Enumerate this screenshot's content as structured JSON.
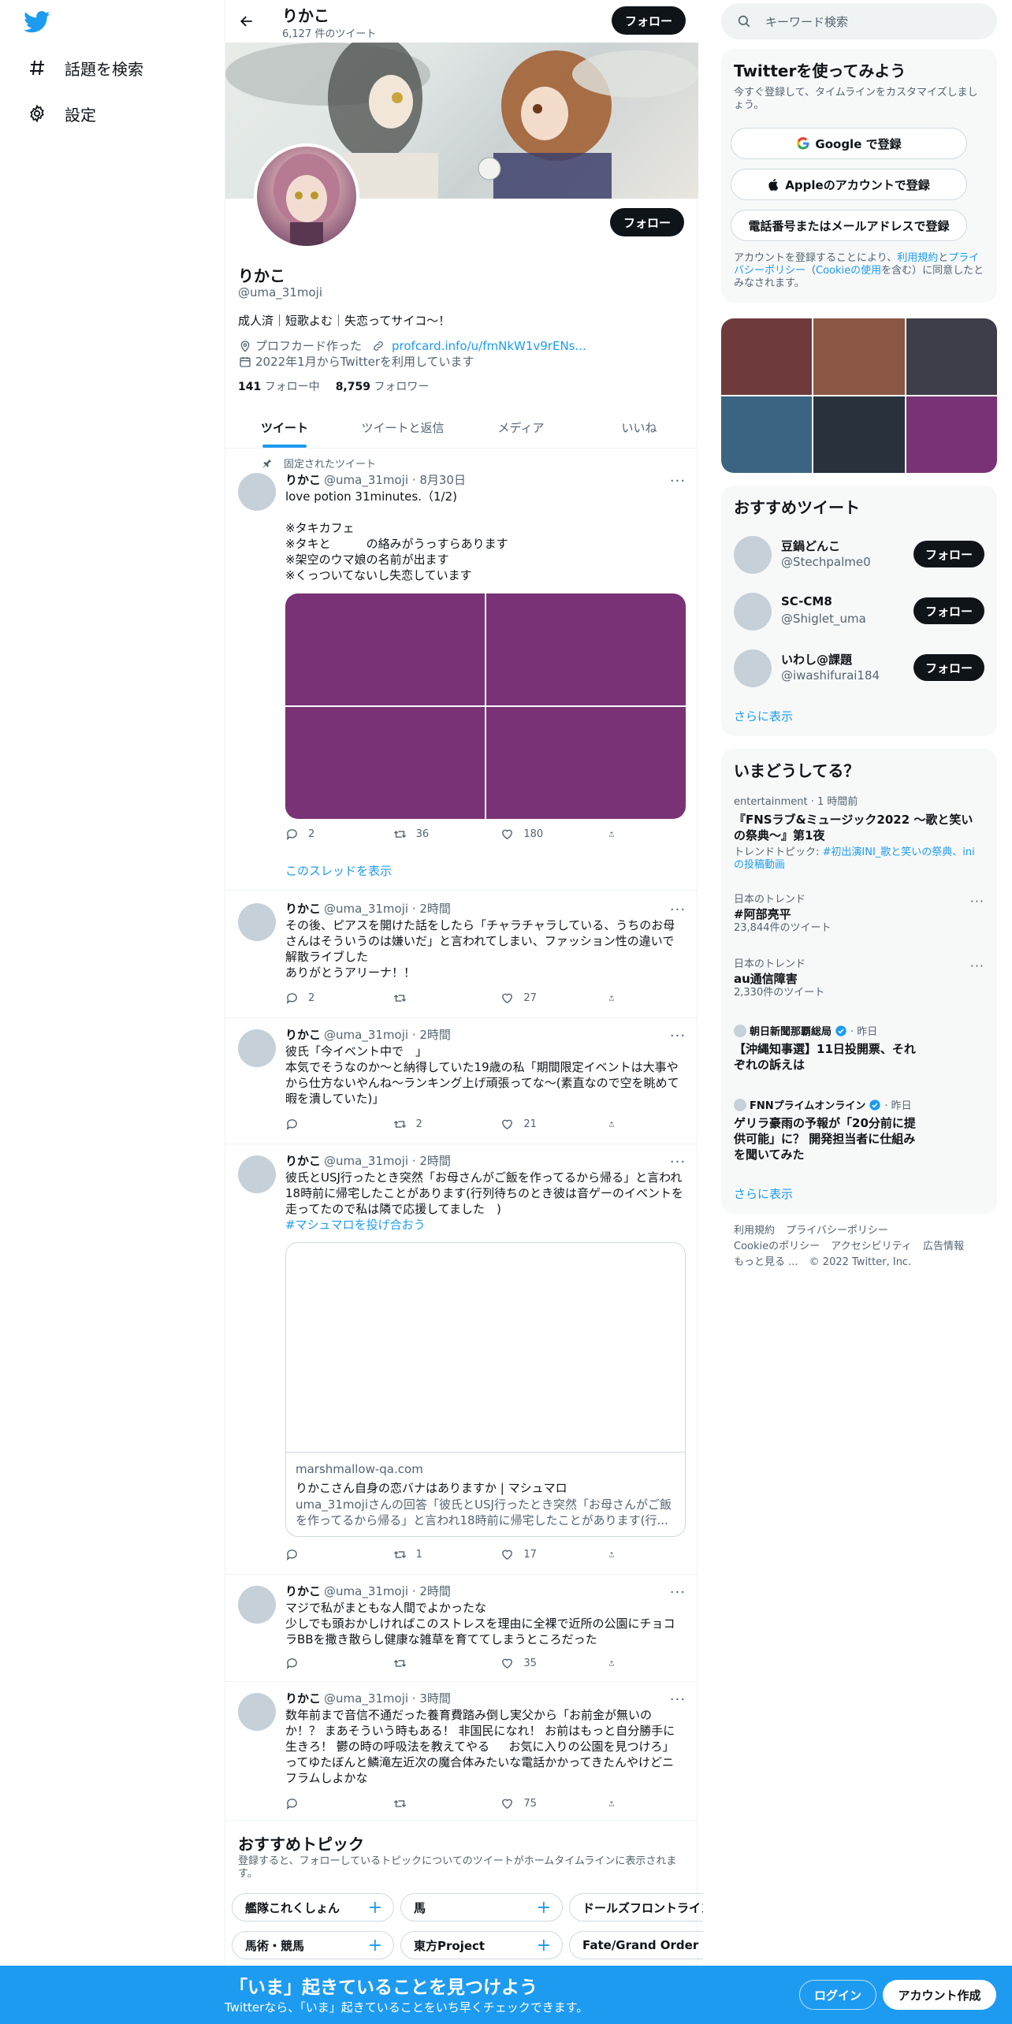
{
  "nav": {
    "items": [
      {
        "icon": "hashtag-icon",
        "label": "話題を検索"
      },
      {
        "icon": "gear-icon",
        "label": "設定"
      }
    ]
  },
  "header": {
    "name": "りかこ",
    "tweet_count": "6,127 件のツイート",
    "follow_label": "フォロー"
  },
  "profile": {
    "name": "りかこ",
    "handle": "@uma_31moji",
    "bio": "成人済｜短歌よむ｜失恋ってサイコ〜！",
    "location": "プロフカード作った",
    "link": "profcard.info/u/fmNkW1v9rENs...",
    "joined": "2022年1月からTwitterを利用しています",
    "following_count": "141",
    "following_label": "フォロー中",
    "followers_count": "8,759",
    "followers_label": "フォロワー",
    "follow_label": "フォロー"
  },
  "tabs": [
    "ツイート",
    "ツイートと返信",
    "メディア",
    "いいね"
  ],
  "tweets": [
    {
      "pinned_label": "固定されたツイート",
      "name": "りかこ",
      "meta": "@uma_31moji · 8月30日",
      "text": "love potion 31minutes.（1/2)\n\n※タキカフェ\n※タキと　　　の絡みがうっすらあります\n※架空のウマ娘の名前が出ます\n※くっついてないし失恋しています",
      "reply": "2",
      "retweet": "36",
      "like": "180",
      "thread_link": "このスレッドを表示"
    },
    {
      "name": "りかこ",
      "meta": "@uma_31moji · 2時間",
      "text": "その後、ピアスを開けた話をしたら「チャラチャラしている、うちのお母さんはそういうのは嫌いだ」と言われてしまい、ファッション性の違いで解散ライブした\nありがとうアリーナ！！",
      "reply": "2",
      "retweet": "",
      "like": "27"
    },
    {
      "name": "りかこ",
      "meta": "@uma_31moji · 2時間",
      "text": "彼氏「今イベント中で　」\n本気でそうなのか〜と納得していた19歳の私「期間限定イベントは大事やから仕方ないやんね〜ランキング上げ頑張ってな〜(素直なので空を眺めて暇を潰していた)」",
      "reply": "",
      "retweet": "2",
      "like": "21"
    },
    {
      "name": "りかこ",
      "meta": "@uma_31moji · 2時間",
      "text": "彼氏とUSJ行ったとき突然「お母さんがご飯を作ってるから帰る」と言われ18時前に帰宅したことがあります(行列待ちのとき彼は音ゲーのイベントを走ってたので私は隣で応援してました　)",
      "hashtag": "#マシュマロを投げ合おう",
      "card_domain": "marshmallow-qa.com",
      "card_title": "りかこさん自身の恋バナはありますか | マシュマロ",
      "card_desc": "uma_31mojiさんの回答「彼氏とUSJ行ったとき突然「お母さんがご飯を作ってるから帰る」と言われ18時前に帰宅したことがあります(行...",
      "reply": "",
      "retweet": "1",
      "like": "17"
    },
    {
      "name": "りかこ",
      "meta": "@uma_31moji · 2時間",
      "text": "マジで私がまともな人間でよかったな\n少しでも頭おかしければこのストレスを理由に全裸で近所の公園にチョコラBBを撒き散らし健康な雑草を育ててしまうところだった",
      "reply": "",
      "retweet": "",
      "like": "35"
    },
    {
      "name": "りかこ",
      "meta": "@uma_31moji · 3時間",
      "text": "数年前まで音信不通だった養育費踏み倒し実父から「お前金が無いのか！？ まあそういう時もある！ 非国民になれ！ お前はもっと自分勝手に生きろ！ 鬱の時の呼吸法を教えてやる　  お気に入りの公園を見つけろ」ってゆたぼんと鱗滝左近次の魔合体みたいな電話かかってきたんやけどニフラムしよかな",
      "reply": "",
      "retweet": "",
      "like": "75"
    }
  ],
  "topics": {
    "title": "おすすめトピック",
    "subtitle": "登録すると、フォローしているトピックについてのツイートがホームタイムラインに表示されます。",
    "row1": [
      "艦隊これくしょん",
      "馬",
      "ドールズフロントライン"
    ],
    "row2": [
      "馬術・競馬",
      "東方Project",
      "Fate/Grand Order"
    ]
  },
  "search": {
    "placeholder": "キーワード検索"
  },
  "signup": {
    "title": "Twitterを使ってみよう",
    "subtitle": "今すぐ登録して、タイムラインをカスタマイズしましょう。",
    "google": "Google で登録",
    "apple": "Appleのアカウントで登録",
    "phone": "電話番号またはメールアドレスで登録",
    "terms_1": "アカウントを登録することにより、",
    "terms_tos": "利用規約",
    "terms_2": "と",
    "terms_pp": "プライバシーポリシー",
    "terms_3": "（",
    "terms_cookie": "Cookieの使用",
    "terms_4": "を含む）に同意したとみなされます。"
  },
  "media_colors": [
    "#6e3a3c",
    "#8a5744",
    "#3d3e48",
    "#3b6482",
    "#28323d",
    "#7a3277"
  ],
  "who_to_follow": {
    "title": "おすすめツイート",
    "users": [
      {
        "name": "豆鍋どんこ",
        "handle": "@Stechpalme0"
      },
      {
        "name": "SC-CM8",
        "handle": "@Shiglet_uma"
      },
      {
        "name": "いわし@課題",
        "handle": "@iwashifurai184"
      }
    ],
    "follow_label": "フォロー",
    "more": "さらに表示"
  },
  "trends": {
    "title": "いまどうしてる？",
    "items": [
      {
        "context": "entertainment · 1 時間前",
        "title": "『FNSラブ&ミュージック2022 〜歌と笑いの祭典〜』第1夜",
        "topic_prefix": "トレンドトピック: ",
        "topic": "#初出演INI_歌と笑いの祭典、iniの投稿動画"
      },
      {
        "context": "日本のトレンド",
        "title": "#阿部亮平",
        "count": "23,844件のツイート"
      },
      {
        "context": "日本のトレンド",
        "title": "au通信障害",
        "count": "2,330件のツイート"
      }
    ],
    "news": [
      {
        "source": "朝日新聞那覇総局",
        "time": "· 昨日",
        "title": "【沖縄知事選】11日投開票、それぞれの訴えは"
      },
      {
        "source": "FNNプライムオンライン",
        "time": "· 昨日",
        "title": "ゲリラ豪雨の予報が「20分前に提供可能」に？ 開発担当者に仕組みを聞いてみた"
      }
    ],
    "more": "さらに表示"
  },
  "footer": {
    "links": [
      "利用規約",
      "プライバシーポリシー",
      "Cookieのポリシー",
      "アクセシビリティ",
      "広告情報",
      "もっと見る ...",
      "© 2022 Twitter, Inc."
    ]
  },
  "bottom_bar": {
    "title": "「いま」起きていることを見つけよう",
    "subtitle": "Twitterなら、「いま」起きていることをいち早くチェックできます。",
    "login": "ログイン",
    "signup": "アカウント作成"
  },
  "colors": {
    "accent": "#1d9bf0",
    "dark": "#0f1419",
    "muted": "#536471"
  }
}
